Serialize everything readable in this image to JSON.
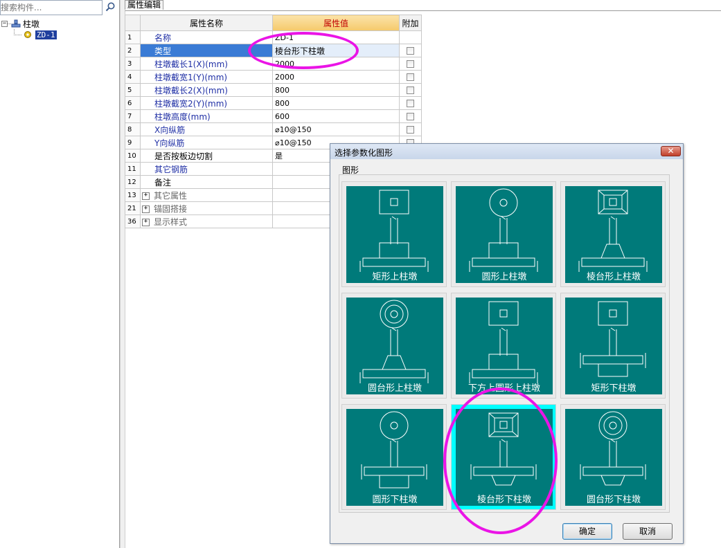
{
  "search": {
    "placeholder": "搜索构件..."
  },
  "tree": {
    "root_label": "柱墩",
    "child_label": "ZD-1"
  },
  "property_panel": {
    "tab_label": "属性编辑",
    "headers": {
      "name": "属性名称",
      "value": "属性值",
      "extra": "附加"
    },
    "rows": [
      {
        "num": "1",
        "name": "名称",
        "value": "ZD-1"
      },
      {
        "num": "2",
        "name": "类型",
        "value": "棱台形下柱墩"
      },
      {
        "num": "3",
        "name": "柱墩截长1(X)(mm)",
        "value": "2000"
      },
      {
        "num": "4",
        "name": "柱墩截宽1(Y)(mm)",
        "value": "2000"
      },
      {
        "num": "5",
        "name": "柱墩截长2(X)(mm)",
        "value": "800"
      },
      {
        "num": "6",
        "name": "柱墩截宽2(Y)(mm)",
        "value": "800"
      },
      {
        "num": "7",
        "name": "柱墩高度(mm)",
        "value": "600"
      },
      {
        "num": "8",
        "name": "X向纵筋",
        "value": "⌀10@150"
      },
      {
        "num": "9",
        "name": "Y向纵筋",
        "value": "⌀10@150"
      },
      {
        "num": "10",
        "name": "是否按板边切割",
        "value": "是"
      },
      {
        "num": "11",
        "name": "其它钢筋",
        "value": ""
      },
      {
        "num": "12",
        "name": "备注",
        "value": ""
      },
      {
        "num": "13",
        "name": "其它属性",
        "value": "",
        "group": true
      },
      {
        "num": "21",
        "name": "锚固搭接",
        "value": "",
        "group": true
      },
      {
        "num": "36",
        "name": "显示样式",
        "value": "",
        "group": true
      }
    ]
  },
  "dialog": {
    "title": "选择参数化图形",
    "close_glyph": "✕",
    "group_label": "图形",
    "shapes": [
      {
        "label": "矩形上柱墩",
        "kind": "rect-top"
      },
      {
        "label": "圆形上柱墩",
        "kind": "circle-top"
      },
      {
        "label": "棱台形上柱墩",
        "kind": "frustum-top"
      },
      {
        "label": "圆台形上柱墩",
        "kind": "cone-top"
      },
      {
        "label": "下方上圆形上柱墩",
        "kind": "square-circle-top"
      },
      {
        "label": "矩形下柱墩",
        "kind": "rect-bottom"
      },
      {
        "label": "圆形下柱墩",
        "kind": "circle-bottom"
      },
      {
        "label": "棱台形下柱墩",
        "kind": "frustum-bottom",
        "selected": true
      },
      {
        "label": "圆台形下柱墩",
        "kind": "cone-bottom"
      }
    ],
    "ok_label": "确定",
    "cancel_label": "取消"
  },
  "colors": {
    "tile": "#007a7a",
    "selected_cell": "#00ffff",
    "annotation": "#ea14e6"
  }
}
